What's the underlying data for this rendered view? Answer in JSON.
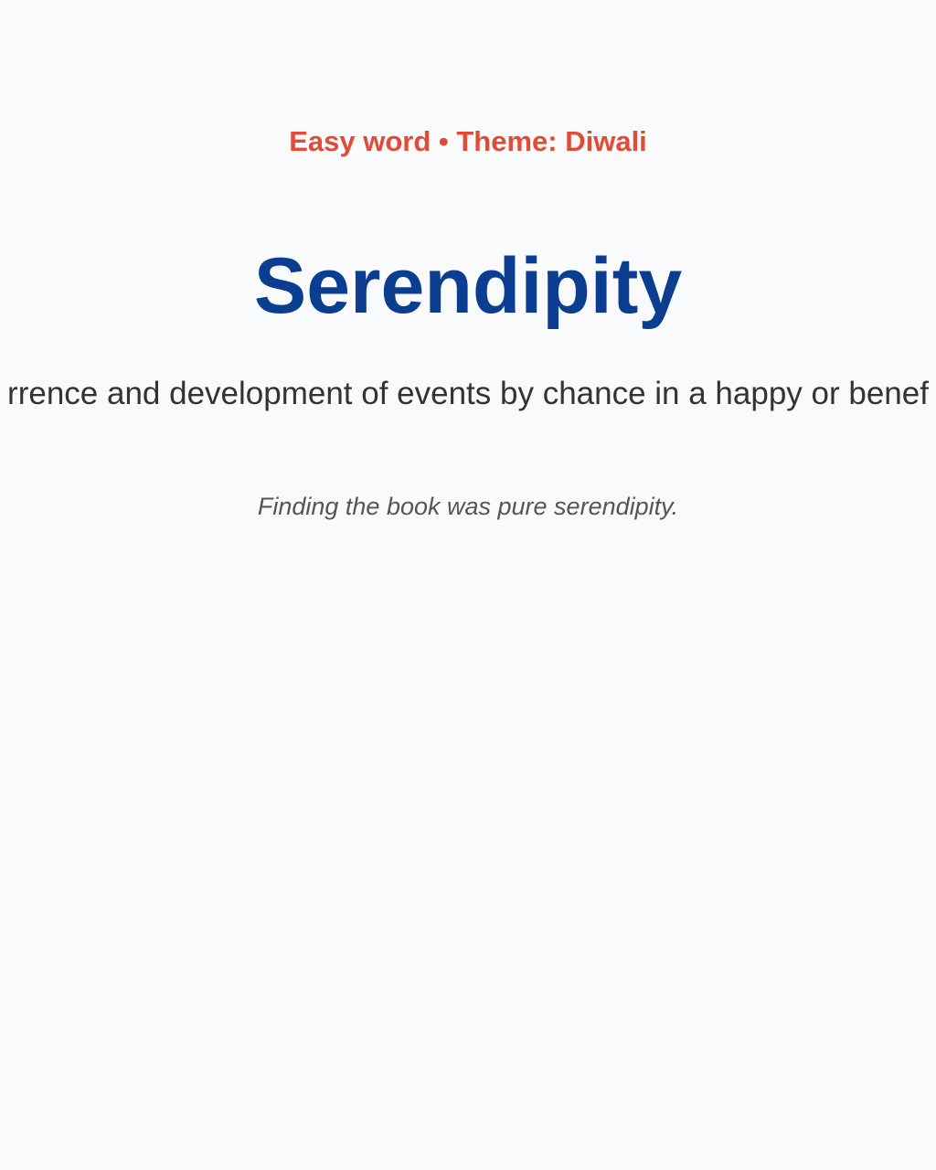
{
  "card": {
    "difficulty": "Easy word",
    "separator": " • ",
    "theme": "Theme: Diwali",
    "word": "Serendipity",
    "definition": "rrence and development of events by chance in a happy or benef",
    "example": "Finding the book was pure serendipity."
  },
  "colors": {
    "background": "#f8fafc",
    "accent": "#e24b36",
    "word": "#0b3d91",
    "definition": "#333333",
    "example": "#555555"
  }
}
